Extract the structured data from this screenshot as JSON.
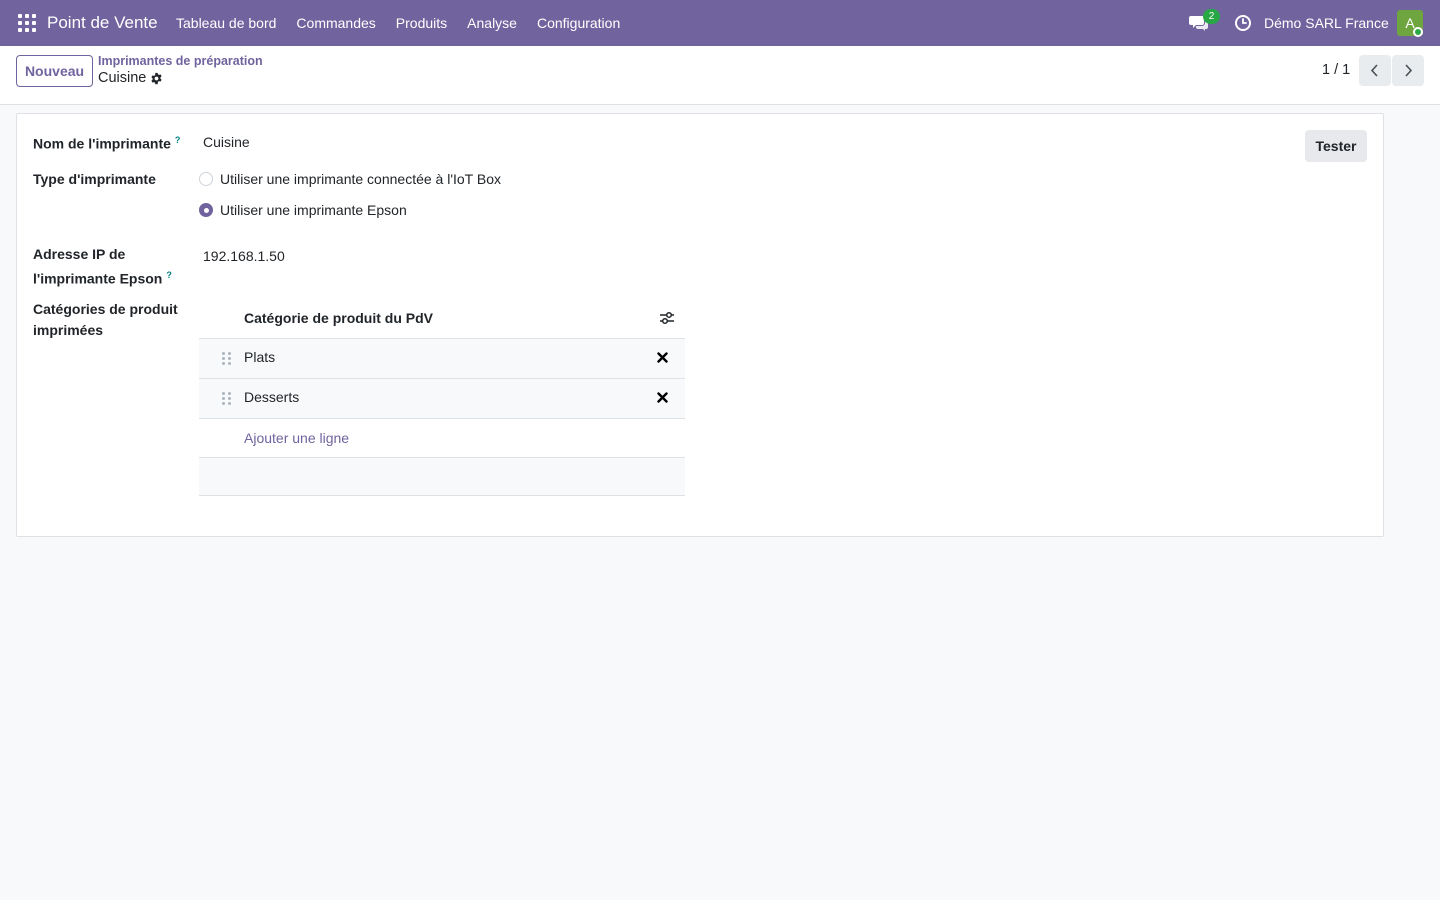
{
  "navbar": {
    "app_name": "Point de Vente",
    "menu": [
      "Tableau de bord",
      "Commandes",
      "Produits",
      "Analyse",
      "Configuration"
    ],
    "chat_badge": "2",
    "company": "Démo SARL France",
    "avatar_letter": "A",
    "accent_color": "#71639e"
  },
  "control_panel": {
    "new_button": "Nouveau",
    "breadcrumb_parent": "Imprimantes de préparation",
    "breadcrumb_current": "Cuisine",
    "pager": "1 / 1"
  },
  "form": {
    "test_button": "Tester",
    "name_label": "Nom de l'imprimante",
    "help_mark": "?",
    "name_value": "Cuisine",
    "type_label": "Type d'imprimante",
    "type_options": [
      {
        "label": "Utiliser une imprimante connectée à l'IoT Box",
        "checked": false
      },
      {
        "label": "Utiliser une imprimante Epson",
        "checked": true
      }
    ],
    "ip_label_line1": "Adresse IP de",
    "ip_label_line2": "l'imprimante Epson",
    "ip_value": "192.168.1.50",
    "categories_label_line1": "Catégories de produit",
    "categories_label_line2": "imprimées",
    "categories_table": {
      "column_header": "Catégorie de produit du PdV",
      "rows": [
        "Plats",
        "Desserts"
      ],
      "add_line": "Ajouter une ligne"
    }
  }
}
